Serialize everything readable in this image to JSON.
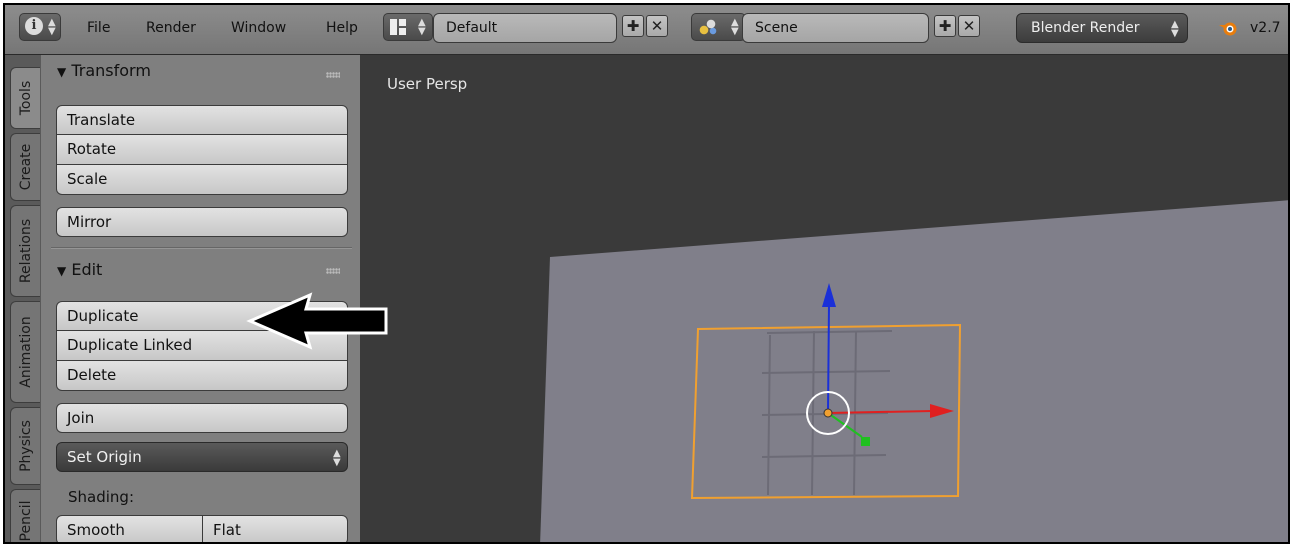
{
  "header": {
    "menus": [
      "File",
      "Render",
      "Window",
      "Help"
    ],
    "layout_name": "Default",
    "scene_name": "Scene",
    "render_engine": "Blender Render",
    "version": "v2.7"
  },
  "sidebar_tabs": [
    "Tools",
    "Create",
    "Relations",
    "Animation",
    "Physics",
    "Pencil"
  ],
  "transform_panel": {
    "title": "Transform",
    "buttons": [
      "Translate",
      "Rotate",
      "Scale"
    ],
    "mirror": "Mirror"
  },
  "edit_panel": {
    "title": "Edit",
    "buttons": [
      "Duplicate",
      "Duplicate Linked",
      "Delete"
    ],
    "join": "Join",
    "set_origin": "Set Origin",
    "shading_label": "Shading:",
    "smooth": "Smooth",
    "flat": "Flat"
  },
  "viewport": {
    "label": "User Persp"
  },
  "colors": {
    "selection_outline": "#f0a030",
    "axis_x": "#e02020",
    "axis_y": "#20c020",
    "axis_z": "#1a30d8",
    "plane": "#807f8a",
    "background": "#3a3a3a"
  }
}
